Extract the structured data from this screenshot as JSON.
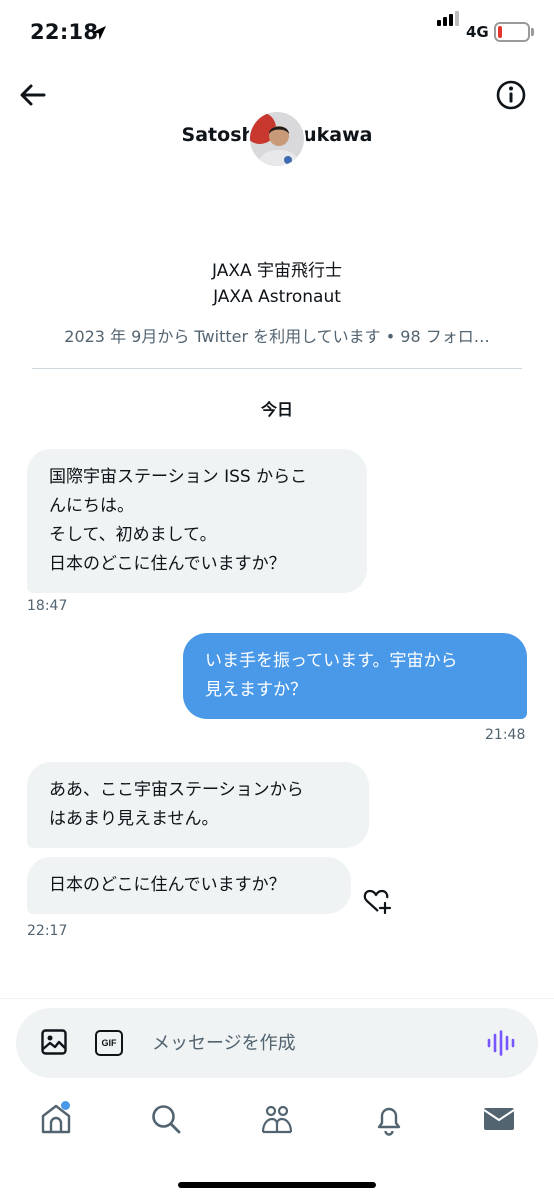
{
  "status_bar": {
    "time": "22:18",
    "network": "4G"
  },
  "header": {
    "name": "Satoshi Furukawa"
  },
  "profile": {
    "bio_line1": "JAXA 宇宙飛行士",
    "bio_line2": "JAXA Astronaut",
    "join_info": "2023 年 9月から Twitter を利用しています • 98 フォロ…"
  },
  "conversation": {
    "day_label": "今日",
    "messages": [
      {
        "text": "国際宇宙ステーション ISS からこ\nんにちは。\nそして、初めまして。\n日本のどこに住んでいますか？"
      },
      {
        "text": "いま手を振っています。宇宙から\n見えますか？"
      },
      {
        "text": "ああ、ここ宇宙ステーションから\nはあまり見えません。"
      },
      {
        "text": "日本のどこに住んでいますか？"
      }
    ],
    "times": [
      "18:47",
      "21:48",
      "22:17"
    ]
  },
  "composer": {
    "placeholder": "メッセージを作成",
    "gif_label": "GIF"
  },
  "icons": {
    "back": "arrow-left-icon",
    "info": "info-icon",
    "image": "image-icon",
    "voice": "voice-wave-icon",
    "reaction": "heart-plus-icon",
    "tabs": [
      "home-icon",
      "search-icon",
      "communities-icon",
      "bell-icon",
      "mail-icon"
    ]
  },
  "colors": {
    "sent_bubble": "#4a99e9",
    "received_bubble": "#eff3f4",
    "voice_accent": "#7856ff",
    "battery_low": "#e5342c"
  }
}
